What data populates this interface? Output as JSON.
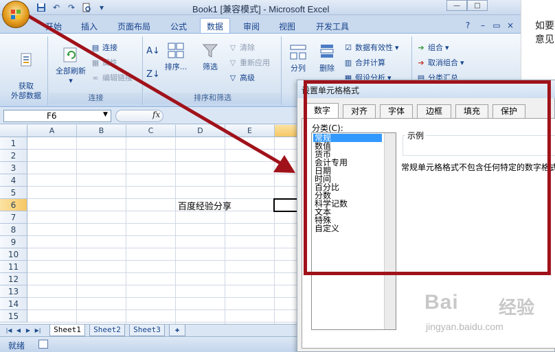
{
  "window": {
    "title": "Book1  [兼容模式] - Microsoft Excel",
    "buttons": [
      "—",
      "□"
    ]
  },
  "quick_access": [
    "save-icon",
    "undo-icon",
    "redo-icon",
    "print-preview-icon",
    "customize-icon"
  ],
  "ribbon_tabs": [
    {
      "label": "开始",
      "active": false
    },
    {
      "label": "插入",
      "active": false
    },
    {
      "label": "页面布局",
      "active": false
    },
    {
      "label": "公式",
      "active": false
    },
    {
      "label": "数据",
      "active": true
    },
    {
      "label": "审阅",
      "active": false
    },
    {
      "label": "视图",
      "active": false
    },
    {
      "label": "开发工具",
      "active": false
    }
  ],
  "ribbon": {
    "get_external": {
      "label": "获取\n外部数据"
    },
    "connections": {
      "group_name": "连接",
      "refresh_all": "全部刷新",
      "connections": "连接",
      "properties": "属性",
      "edit_links": "编辑链接"
    },
    "sort_filter": {
      "group_name": "排序和筛选",
      "sort": "排序...",
      "filter": "筛选",
      "clear": "清除",
      "reapply": "重新应用",
      "advanced": "高级"
    },
    "data_tools": {
      "text_to_columns": "分列",
      "remove_duplicates": "删除",
      "validation": "数据有效性",
      "consolidate": "合并计算",
      "what_if": "假设分析"
    },
    "outline": {
      "group": "组合",
      "ungroup": "取消组合",
      "subtotal": "分类汇总"
    }
  },
  "formula_bar": {
    "name_box": "F6",
    "fx": "fx"
  },
  "grid": {
    "columns": [
      "A",
      "B",
      "C",
      "D",
      "E"
    ],
    "rows": [
      "1",
      "2",
      "3",
      "4",
      "5",
      "6",
      "7",
      "8",
      "9",
      "10",
      "11",
      "12",
      "13",
      "14",
      "15"
    ],
    "selected_row": "6",
    "cell_text": "百度经验分享"
  },
  "sheets": [
    "Sheet1",
    "Sheet2",
    "Sheet3"
  ],
  "status": "就绪",
  "side_panel": {
    "line1": "如要",
    "line2": "意见"
  },
  "dialog": {
    "title": "设置单元格格式",
    "tabs": [
      {
        "label": "数字",
        "active": true
      },
      {
        "label": "对齐",
        "active": false
      },
      {
        "label": "字体",
        "active": false
      },
      {
        "label": "边框",
        "active": false
      },
      {
        "label": "填充",
        "active": false
      },
      {
        "label": "保护",
        "active": false
      }
    ],
    "category_label": "分类(C):",
    "categories": [
      "常规",
      "数值",
      "货币",
      "会计专用",
      "日期",
      "时间",
      "百分比",
      "分数",
      "科学记数",
      "文本",
      "特殊",
      "自定义"
    ],
    "selected_category": "常规",
    "sample_label": "示例",
    "description": "常规单元格格式不包含任何特定的数字格式"
  },
  "watermark": {
    "brand": "Bai",
    "suffix": "经验",
    "url": "jingyan.baidu.com"
  },
  "colors": {
    "annotation_red": "#a0121a",
    "ribbon_blue": "#15428b",
    "selection_blue": "#3399ff"
  }
}
